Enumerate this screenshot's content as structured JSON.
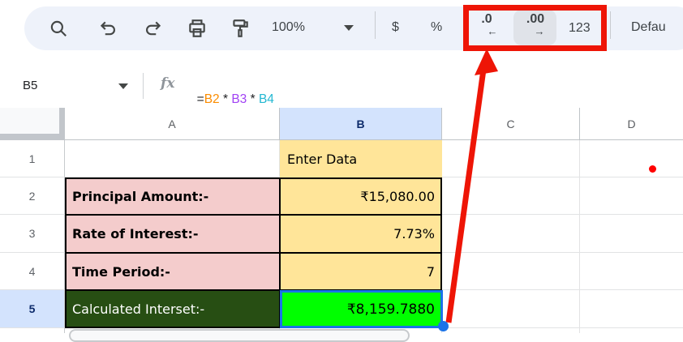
{
  "toolbar": {
    "zoom": "100%",
    "currency": "$",
    "percent": "%",
    "decrease_decimal": ".0",
    "decrease_arrow": "←",
    "increase_decimal": ".00",
    "increase_arrow": "→",
    "more_formats": "123",
    "font_name": "Defau",
    "icons": [
      "search",
      "undo",
      "redo",
      "print",
      "paint-format",
      "zoom-dropdown",
      "decrease-decimal",
      "increase-decimal",
      "more-formats"
    ]
  },
  "formula_bar": {
    "name_box": "B5",
    "fx_label": "fx",
    "tokens": [
      {
        "text": "=",
        "color": "#202124"
      },
      {
        "text": "B2",
        "color": "#fb8c00"
      },
      {
        "text": " * ",
        "color": "#202124"
      },
      {
        "text": "B3",
        "color": "#a142f4"
      },
      {
        "text": " * ",
        "color": "#202124"
      },
      {
        "text": "B4",
        "color": "#24b8d2"
      }
    ],
    "formula_text": "=B2 * B3 * B4"
  },
  "grid": {
    "column_headers": [
      "A",
      "B",
      "C",
      "D"
    ],
    "selected_column": "B",
    "selected_row": "5",
    "rows": [
      {
        "num": "1",
        "a": "",
        "b": "Enter Data"
      },
      {
        "num": "2",
        "a": "Principal Amount:-",
        "b": "₹15,080.00"
      },
      {
        "num": "3",
        "a": "Rate of Interest:-",
        "b": "7.73%"
      },
      {
        "num": "4",
        "a": "Time Period:-",
        "b": "7"
      },
      {
        "num": "5",
        "a": "Calculated Interset:-",
        "b": "₹8,159.7880"
      }
    ]
  },
  "colors": {
    "toolbar_bg": "#eef2fa",
    "label_cell_bg": "#f4cccc",
    "value_cell_bg": "#ffe599",
    "result_label_bg": "#274e13",
    "result_value_bg": "#00ff00",
    "selection_blue": "#1a73e8",
    "header_selected_bg": "#d3e3fd",
    "annotation_red": "#ee1506"
  }
}
